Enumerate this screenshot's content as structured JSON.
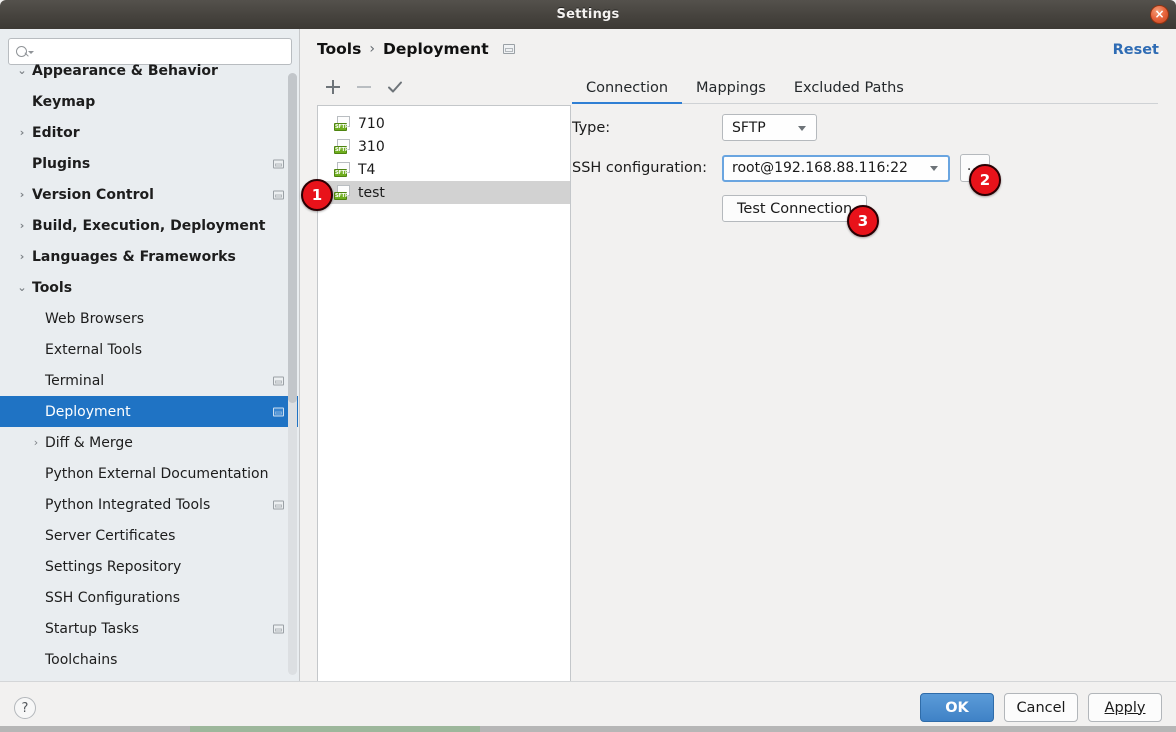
{
  "window": {
    "title": "Settings",
    "close_icon": "close-icon"
  },
  "sidebar": {
    "search": {
      "value": "",
      "placeholder": "",
      "icon": "search-icon"
    },
    "items": [
      {
        "label": "Appearance & Behavior",
        "level": 0,
        "chevron": "chevron-down",
        "badge": false,
        "selected": false
      },
      {
        "label": "Keymap",
        "level": 0,
        "chevron": "",
        "badge": false,
        "selected": false
      },
      {
        "label": "Editor",
        "level": 0,
        "chevron": "chevron-right",
        "badge": false,
        "selected": false
      },
      {
        "label": "Plugins",
        "level": 0,
        "chevron": "",
        "badge": true,
        "selected": false
      },
      {
        "label": "Version Control",
        "level": 0,
        "chevron": "chevron-right",
        "badge": true,
        "selected": false
      },
      {
        "label": "Build, Execution, Deployment",
        "level": 0,
        "chevron": "chevron-right",
        "badge": false,
        "selected": false
      },
      {
        "label": "Languages & Frameworks",
        "level": 0,
        "chevron": "chevron-right",
        "badge": false,
        "selected": false
      },
      {
        "label": "Tools",
        "level": 0,
        "chevron": "chevron-down",
        "badge": false,
        "selected": false
      },
      {
        "label": "Web Browsers",
        "level": 1,
        "chevron": "",
        "badge": false,
        "selected": false
      },
      {
        "label": "External Tools",
        "level": 1,
        "chevron": "",
        "badge": false,
        "selected": false
      },
      {
        "label": "Terminal",
        "level": 1,
        "chevron": "",
        "badge": true,
        "selected": false
      },
      {
        "label": "Deployment",
        "level": 1,
        "chevron": "",
        "badge": true,
        "selected": true
      },
      {
        "label": "Diff & Merge",
        "level": 1,
        "chevron": "chevron-right",
        "badge": false,
        "selected": false
      },
      {
        "label": "Python External Documentation",
        "level": 1,
        "chevron": "",
        "badge": false,
        "selected": false
      },
      {
        "label": "Python Integrated Tools",
        "level": 1,
        "chevron": "",
        "badge": true,
        "selected": false
      },
      {
        "label": "Server Certificates",
        "level": 1,
        "chevron": "",
        "badge": false,
        "selected": false
      },
      {
        "label": "Settings Repository",
        "level": 1,
        "chevron": "",
        "badge": false,
        "selected": false
      },
      {
        "label": "SSH Configurations",
        "level": 1,
        "chevron": "",
        "badge": false,
        "selected": false
      },
      {
        "label": "Startup Tasks",
        "level": 1,
        "chevron": "",
        "badge": true,
        "selected": false
      },
      {
        "label": "Toolchains",
        "level": 1,
        "chevron": "",
        "badge": false,
        "selected": false
      }
    ]
  },
  "content": {
    "breadcrumb": {
      "parent": "Tools",
      "separator": "›",
      "current": "Deployment"
    },
    "reset_label": "Reset",
    "toolbar": {
      "add_icon": "plus-icon",
      "remove_icon": "minus-icon",
      "default_icon": "check-icon"
    },
    "servers": [
      {
        "name": "710",
        "type": "SFTP",
        "selected": false
      },
      {
        "name": "310",
        "type": "SFTP",
        "selected": false
      },
      {
        "name": "T4",
        "type": "SFTP",
        "selected": false
      },
      {
        "name": "test",
        "type": "SFTP",
        "selected": true
      }
    ],
    "tabs": [
      {
        "label": "Connection",
        "active": true
      },
      {
        "label": "Mappings",
        "active": false
      },
      {
        "label": "Excluded Paths",
        "active": false
      }
    ],
    "form": {
      "type_label": "Type:",
      "type_value": "SFTP",
      "ssh_label": "SSH configuration:",
      "ssh_value": "root@192.168.88.116:22",
      "browse_label": "...",
      "test_connection_label": "Test Connection"
    }
  },
  "footer": {
    "help_label": "?",
    "ok_label": "OK",
    "cancel_label": "Cancel",
    "apply_label": "Apply"
  },
  "annotations": [
    {
      "number": "1",
      "target": "server-list-item-test"
    },
    {
      "number": "2",
      "target": "ssh-browse-button"
    },
    {
      "number": "3",
      "target": "test-connection-button"
    }
  ],
  "colors": {
    "accent": "#1f73c4",
    "link": "#2f6cb4",
    "selection": "#1f73c4",
    "annotation": "#e8121a",
    "sftp_badge": "#6fae1f"
  }
}
